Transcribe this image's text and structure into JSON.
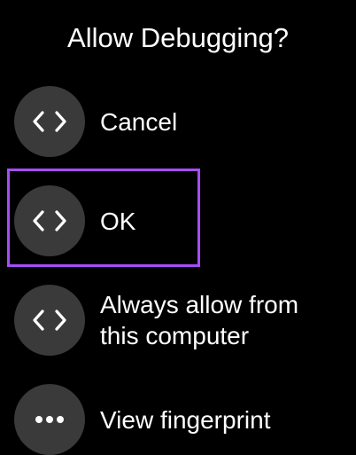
{
  "dialog": {
    "title": "Allow Debugging?",
    "accent_color": "#a64df5",
    "chip_color": "#3a3a3a",
    "options": [
      {
        "label": "Cancel",
        "icon": "code-brackets-icon"
      },
      {
        "label": "OK",
        "icon": "code-brackets-icon",
        "focused": true
      },
      {
        "label": "Always allow from\nthis computer",
        "icon": "code-brackets-icon"
      },
      {
        "label": "View fingerprint",
        "icon": "more-horiz-icon"
      }
    ]
  }
}
